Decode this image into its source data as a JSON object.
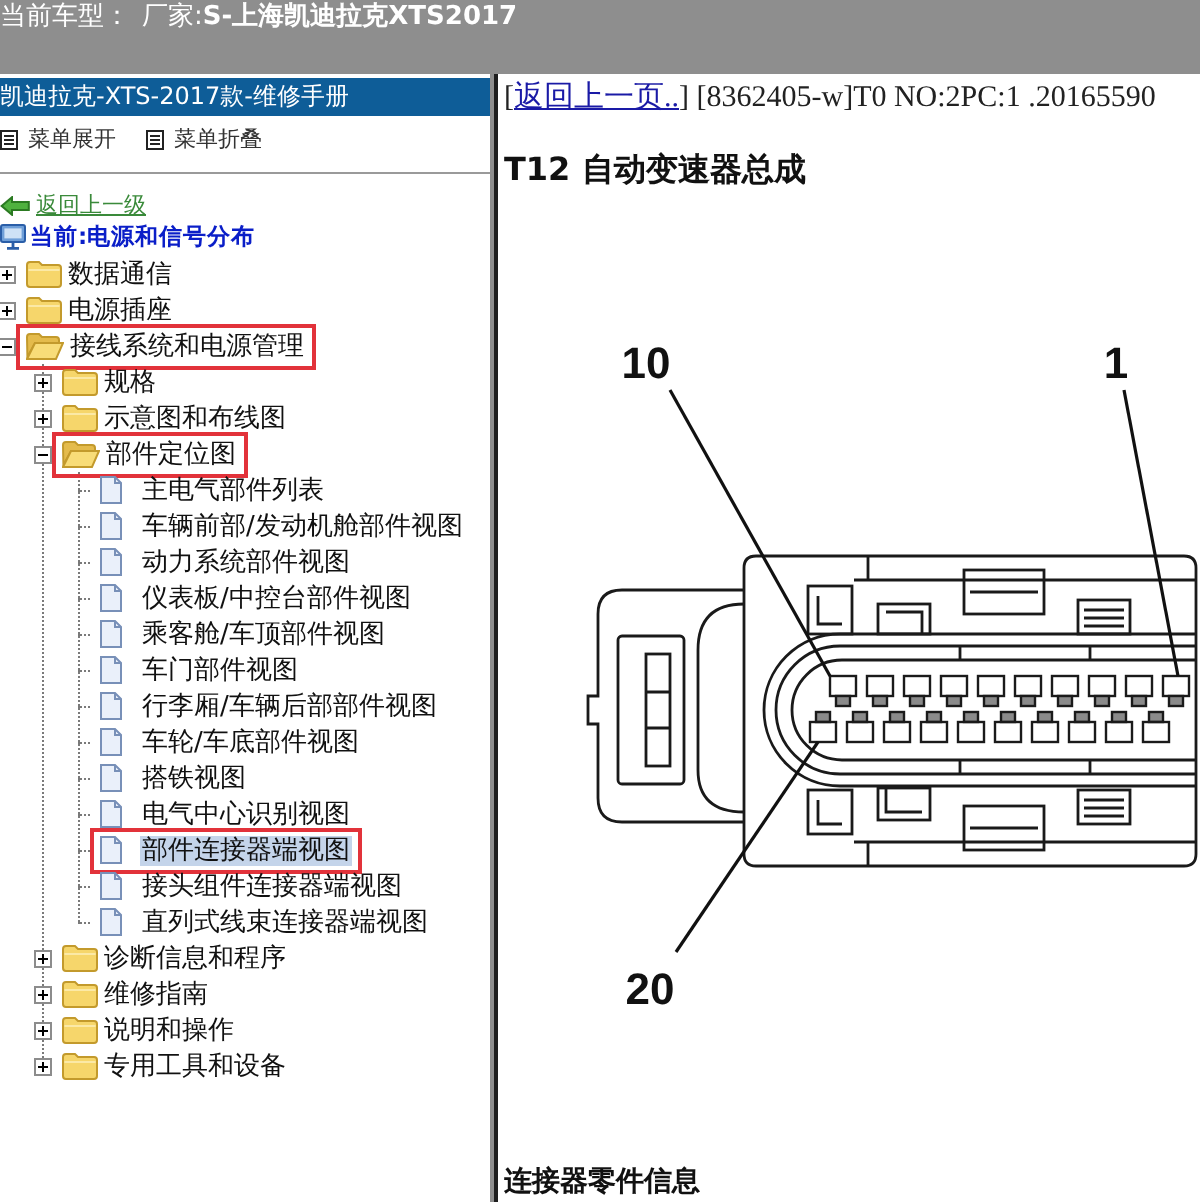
{
  "top_bar": {
    "label": "当前车型：",
    "value": "厂家:**S-上海凯迪拉克XTS2017**"
  },
  "sidebar": {
    "title": "凯迪拉克-XTS-2017款-维修手册",
    "toolbar": [
      {
        "label": "菜单展开"
      },
      {
        "label": "菜单折叠"
      }
    ],
    "back_link": "返回上一级",
    "current": "当前:电源和信号分布",
    "tree": [
      {
        "label": "数据通信",
        "kind": "folder",
        "expanded": false,
        "selected": false,
        "annotated": false
      },
      {
        "label": "电源插座",
        "kind": "folder",
        "expanded": false,
        "selected": false,
        "annotated": false
      },
      {
        "label": "接线系统和电源管理",
        "kind": "folder",
        "expanded": true,
        "selected": false,
        "annotated": true,
        "children": [
          {
            "label": "规格",
            "kind": "folder",
            "expanded": false,
            "selected": false,
            "annotated": false
          },
          {
            "label": "示意图和布线图",
            "kind": "folder",
            "expanded": false,
            "selected": false,
            "annotated": false
          },
          {
            "label": "部件定位图",
            "kind": "folder",
            "expanded": true,
            "selected": false,
            "annotated": true,
            "children": [
              {
                "label": "主电气部件列表",
                "kind": "page",
                "selected": false,
                "annotated": false
              },
              {
                "label": "车辆前部/发动机舱部件视图",
                "kind": "page",
                "selected": false,
                "annotated": false
              },
              {
                "label": "动力系统部件视图",
                "kind": "page",
                "selected": false,
                "annotated": false
              },
              {
                "label": "仪表板/中控台部件视图",
                "kind": "page",
                "selected": false,
                "annotated": false
              },
              {
                "label": "乘客舱/车顶部件视图",
                "kind": "page",
                "selected": false,
                "annotated": false
              },
              {
                "label": "车门部件视图",
                "kind": "page",
                "selected": false,
                "annotated": false
              },
              {
                "label": "行李厢/车辆后部部件视图",
                "kind": "page",
                "selected": false,
                "annotated": false
              },
              {
                "label": "车轮/车底部件视图",
                "kind": "page",
                "selected": false,
                "annotated": false
              },
              {
                "label": "搭铁视图",
                "kind": "page",
                "selected": false,
                "annotated": false
              },
              {
                "label": "电气中心识别视图",
                "kind": "page",
                "selected": false,
                "annotated": false
              },
              {
                "label": "部件连接器端视图",
                "kind": "page",
                "selected": true,
                "annotated": true
              },
              {
                "label": "接头组件连接器端视图",
                "kind": "page",
                "selected": false,
                "annotated": false
              },
              {
                "label": "直列式线束连接器端视图",
                "kind": "page",
                "selected": false,
                "annotated": false
              }
            ]
          },
          {
            "label": "诊断信息和程序",
            "kind": "folder",
            "expanded": false,
            "selected": false,
            "annotated": false
          },
          {
            "label": "维修指南",
            "kind": "folder",
            "expanded": false,
            "selected": false,
            "annotated": false
          },
          {
            "label": "说明和操作",
            "kind": "folder",
            "expanded": false,
            "selected": false,
            "annotated": false
          },
          {
            "label": "专用工具和设备",
            "kind": "folder",
            "expanded": false,
            "selected": false,
            "annotated": false
          }
        ]
      }
    ]
  },
  "content": {
    "nav": {
      "open": "[",
      "link": "返回上一页..",
      "close": "] [8362405-w]T0 NO:2PC:1 .20165590"
    },
    "title": "T12 自动变速器总成",
    "figure": {
      "callouts": [
        "10",
        "1",
        "20"
      ]
    },
    "section_title": "连接器零件信息"
  }
}
